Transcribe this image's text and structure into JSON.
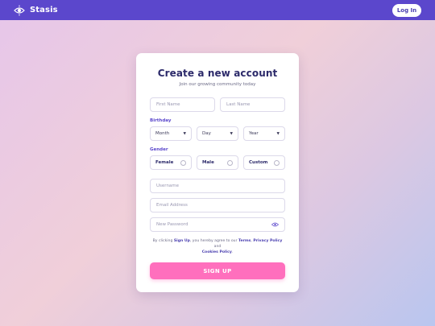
{
  "header": {
    "brand_name": "Stasis",
    "brand_icon": "eye-logo-icon",
    "login_label": "Log In",
    "bar_color": "#5b47cc"
  },
  "form": {
    "title": "Create a new account",
    "subtitle": "Join our growing community today",
    "first_name_placeholder": "First Name",
    "last_name_placeholder": "Last Name",
    "birthday_label": "Birthday",
    "month_value": "Month",
    "day_value": "Day",
    "year_value": "Year",
    "gender_label": "Gender",
    "gender_options": [
      "Female",
      "Male",
      "Custom"
    ],
    "username_placeholder": "Username",
    "email_placeholder": "Email Address",
    "password_placeholder": "New Password",
    "terms_prefix": "By clicking",
    "terms_signup": "Sign Up",
    "terms_middle": ", you hereby agree to our",
    "terms_terms": "Terms",
    "terms_comma": ",",
    "terms_privacy": "Privacy Policy",
    "terms_and": "and",
    "terms_cookies": "Cookies Policy",
    "terms_end": ".",
    "signup_label": "SIGN UP",
    "signup_color": "#ff6fbd"
  }
}
